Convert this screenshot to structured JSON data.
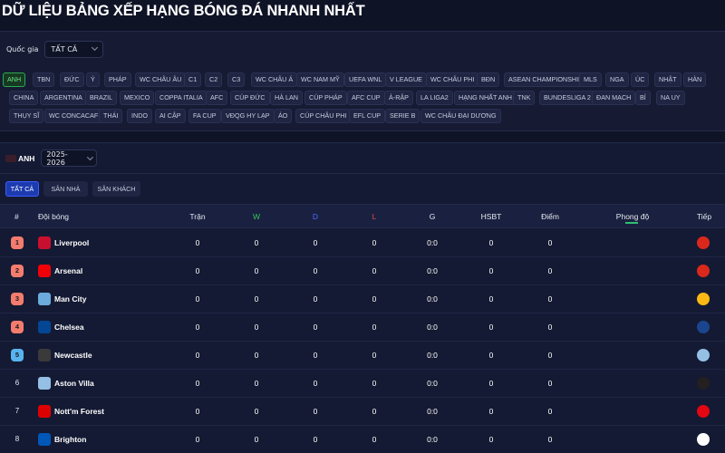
{
  "page": {
    "title": "DỮ LIỆU BẢNG XẾP HẠNG BÓNG ĐÁ NHANH NHẤT"
  },
  "filter": {
    "country_label": "Quốc gia",
    "country_value": "TẤT CẢ",
    "league_rows": [
      [
        "ANH",
        "TBN",
        "ĐỨC",
        "Ý",
        "PHÁP",
        "WC CHÂU ÂU",
        "C1",
        "C2",
        "C3",
        "WC CHÂU Á",
        "WC NAM MỸ",
        "UEFA WNL",
        "V LEAGUE",
        "WC CHÂU PHI",
        "BĐN",
        "ASEAN CHAMPIONSHIP",
        "MLS",
        "NGA",
        "ÚC",
        "NHẬT",
        "HÀN"
      ],
      [
        "CHINA",
        "ARGENTINA",
        "BRAZIL",
        "MEXICO",
        "COPPA ITALIA",
        "AFC",
        "CÚP ĐỨC",
        "HÀ LAN",
        "CÚP PHÁP",
        "AFC CUP",
        "Ả-RẬP",
        "LA LIGA2",
        "HẠNG NHẤT ANH",
        "TNK",
        "BUNDESLIGA 2",
        "ĐAN MẠCH",
        "BỈ",
        "NA UY"
      ],
      [
        "THỤY SĨ",
        "WC CONCACAF",
        "THÁI",
        "INDO",
        "AI CẬP",
        "FA CUP",
        "VĐQG HY LẠP",
        "ÁO",
        "CÚP CHÂU PHI",
        "EFL CUP",
        "SERIE B",
        "WC CHÂU ĐẠI DƯƠNG"
      ]
    ],
    "active_league": "ANH"
  },
  "standings": {
    "league_label": "ANH",
    "season_value": "2025-2026",
    "tabs": [
      "TẤT CẢ",
      "SÂN NHÀ",
      "SÂN KHÁCH"
    ],
    "active_tab": "TẤT CẢ",
    "columns": {
      "rank": "#",
      "team": "Đội bóng",
      "played": "Trận",
      "win": "W",
      "draw": "D",
      "loss": "L",
      "goals": "G",
      "gd": "HSBT",
      "points": "Điểm",
      "form": "Phong độ",
      "next": "Tiếp"
    },
    "rows": [
      {
        "rank": "1",
        "team": "Liverpool",
        "played": "0",
        "win": "0",
        "draw": "0",
        "loss": "0",
        "goals": "0:0",
        "gd": "0",
        "points": "0",
        "badge": "#f47c6e",
        "crest": "#c8102e",
        "next_crest": "#da291c"
      },
      {
        "rank": "2",
        "team": "Arsenal",
        "played": "0",
        "win": "0",
        "draw": "0",
        "loss": "0",
        "goals": "0:0",
        "gd": "0",
        "points": "0",
        "badge": "#f47c6e",
        "crest": "#ef0107",
        "next_crest": "#da291c"
      },
      {
        "rank": "3",
        "team": "Man City",
        "played": "0",
        "win": "0",
        "draw": "0",
        "loss": "0",
        "goals": "0:0",
        "gd": "0",
        "points": "0",
        "badge": "#f47c6e",
        "crest": "#6cabdd",
        "next_crest": "#fdb913"
      },
      {
        "rank": "4",
        "team": "Chelsea",
        "played": "0",
        "win": "0",
        "draw": "0",
        "loss": "0",
        "goals": "0:0",
        "gd": "0",
        "points": "0",
        "badge": "#f47c6e",
        "crest": "#034694",
        "next_crest": "#1b458f"
      },
      {
        "rank": "5",
        "team": "Newcastle",
        "played": "0",
        "win": "0",
        "draw": "0",
        "loss": "0",
        "goals": "0:0",
        "gd": "0",
        "points": "0",
        "badge": "#58b4ee",
        "crest": "#3a3a3a",
        "next_crest": "#95bfe5"
      },
      {
        "rank": "6",
        "team": "Aston Villa",
        "played": "0",
        "win": "0",
        "draw": "0",
        "loss": "0",
        "goals": "0:0",
        "gd": "0",
        "points": "0",
        "badge": "",
        "crest": "#95bfe5",
        "next_crest": "#241f20"
      },
      {
        "rank": "7",
        "team": "Nott'm Forest",
        "played": "0",
        "win": "0",
        "draw": "0",
        "loss": "0",
        "goals": "0:0",
        "gd": "0",
        "points": "0",
        "badge": "",
        "crest": "#dd0000",
        "next_crest": "#e30613"
      },
      {
        "rank": "8",
        "team": "Brighton",
        "played": "0",
        "win": "0",
        "draw": "0",
        "loss": "0",
        "goals": "0:0",
        "gd": "0",
        "points": "0",
        "badge": "",
        "crest": "#0057b8",
        "next_crest": "#ffffff"
      }
    ]
  }
}
